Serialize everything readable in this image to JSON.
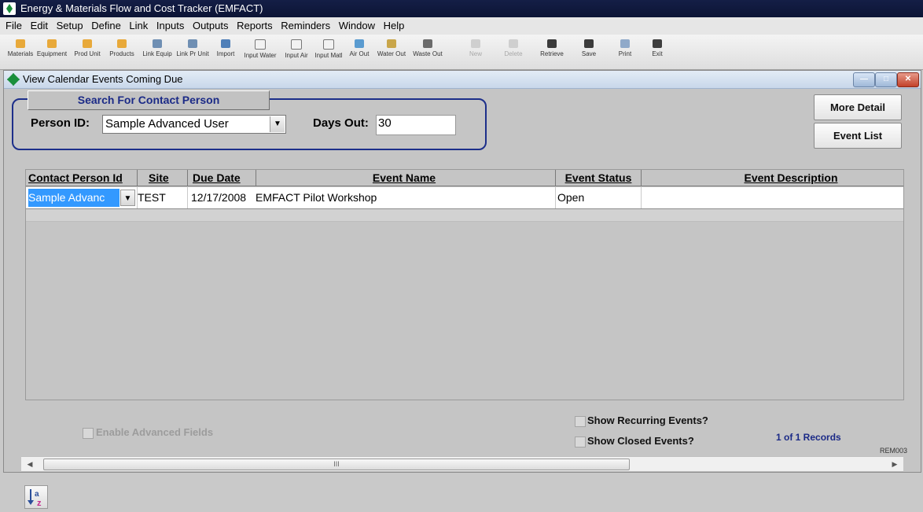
{
  "app": {
    "title": "Energy & Materials Flow and Cost Tracker (EMFACT)"
  },
  "menu": [
    "File",
    "Edit",
    "Setup",
    "Define",
    "Link",
    "Inputs",
    "Outputs",
    "Reports",
    "Reminders",
    "Window",
    "Help"
  ],
  "toolbar": [
    {
      "label": "Materials",
      "icon": "folder-icon",
      "color": "#e8a93a",
      "enabled": true
    },
    {
      "label": "Equipment",
      "icon": "folder-icon",
      "color": "#e8a93a",
      "enabled": true
    },
    {
      "label": "Prod Unit",
      "icon": "folder-icon",
      "color": "#e8a93a",
      "enabled": true
    },
    {
      "label": "Products",
      "icon": "folder-icon",
      "color": "#e8a93a",
      "enabled": true
    },
    {
      "label": "Link Equip",
      "icon": "window-icon",
      "color": "#6f8fb3",
      "enabled": true
    },
    {
      "label": "Link Pr Unit",
      "icon": "window-icon",
      "color": "#6f8fb3",
      "enabled": true
    },
    {
      "label": "Import",
      "icon": "import-icon",
      "color": "#4f7fb8",
      "enabled": true
    },
    {
      "label": "Input Water",
      "icon": "page-icon",
      "color": "#f2f2f2",
      "enabled": true
    },
    {
      "label": "Input Air",
      "icon": "page-icon",
      "color": "#f2f2f2",
      "enabled": true
    },
    {
      "label": "Input Matl",
      "icon": "page-icon",
      "color": "#f2f2f2",
      "enabled": true
    },
    {
      "label": "Air Out",
      "icon": "image-icon",
      "color": "#5a9bd0",
      "enabled": true
    },
    {
      "label": "Water Out",
      "icon": "bin-icon",
      "color": "#c9a64a",
      "enabled": true
    },
    {
      "label": "Waste Out",
      "icon": "truck-icon",
      "color": "#6b6b6b",
      "enabled": true
    },
    {
      "label": "New",
      "icon": "new-icon",
      "color": "#b7b7b7",
      "enabled": false
    },
    {
      "label": "Delete",
      "icon": "delete-icon",
      "color": "#b7b7b7",
      "enabled": false
    },
    {
      "label": "Retrieve",
      "icon": "disk-icon",
      "color": "#3b3b3b",
      "enabled": true
    },
    {
      "label": "Save",
      "icon": "disk-icon",
      "color": "#3b3b3b",
      "enabled": true
    },
    {
      "label": "Print",
      "icon": "printer-icon",
      "color": "#8fa9c9",
      "enabled": true
    },
    {
      "label": "Exit",
      "icon": "exit-icon",
      "color": "#3e3e3e",
      "enabled": true
    }
  ],
  "window": {
    "title": "View Calendar Events Coming Due",
    "search": {
      "heading": "Search For Contact Person",
      "person_label": "Person ID:",
      "person_value": "Sample Advanced User",
      "days_label": "Days Out:",
      "days_value": "30"
    },
    "buttons": {
      "more_detail": "More Detail",
      "event_list": "Event List"
    },
    "table": {
      "columns": [
        "Contact Person Id",
        "Site",
        "Due Date",
        "Event Name",
        "Event Status",
        "Event Description"
      ],
      "rows": [
        {
          "contact": "Sample Advanc",
          "site": "TEST",
          "due_date": "12/17/2008",
          "event_name": "EMFACT Pilot Workshop",
          "status": "Open",
          "description": ""
        }
      ]
    },
    "scroll_thumb_label": "III",
    "footer": {
      "enable_advanced": "Enable Advanced Fields",
      "show_recurring": "Show Recurring Events?",
      "show_closed": "Show Closed Events?",
      "records": "1 of 1 Records",
      "form_code": "REM003"
    },
    "colors": {
      "accent_blue": "#1b2a87",
      "selection": "#3399ff",
      "group_border": "#1d2f8a"
    }
  }
}
